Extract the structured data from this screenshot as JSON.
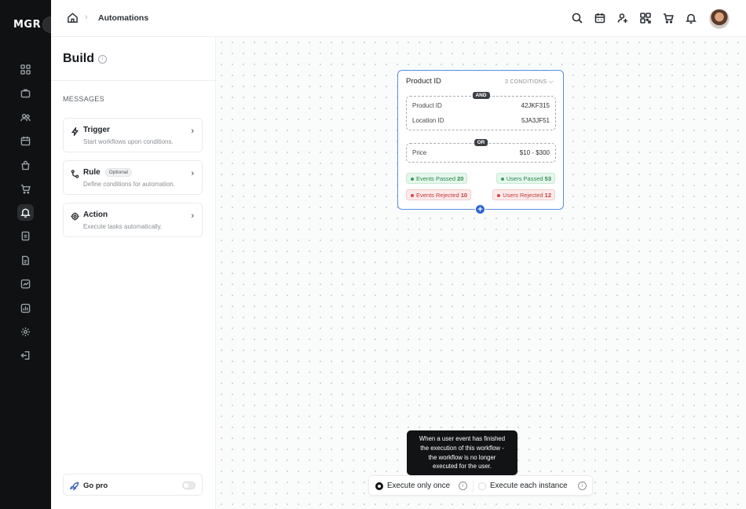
{
  "app": {
    "logo": "MGR"
  },
  "rail": {
    "items": [
      {
        "icon": "grid-icon"
      },
      {
        "icon": "briefcase-icon"
      },
      {
        "icon": "users-icon"
      },
      {
        "icon": "calendar-icon"
      },
      {
        "icon": "bag-icon"
      },
      {
        "icon": "cart-icon"
      },
      {
        "icon": "bell-icon",
        "active": true
      },
      {
        "icon": "document-icon"
      },
      {
        "icon": "file-icon"
      },
      {
        "icon": "chart-check-icon"
      },
      {
        "icon": "bar-chart-icon"
      },
      {
        "icon": "settings-icon"
      },
      {
        "icon": "logout-icon"
      }
    ]
  },
  "topbar": {
    "breadcrumb": "Automations",
    "icons": [
      "search-icon",
      "calendar-icon",
      "user-add-icon",
      "qr-icon",
      "cart-icon",
      "bell-icon"
    ]
  },
  "panel": {
    "title": "Build",
    "info_glyph": "i",
    "section_label": "MESSAGES",
    "cards": {
      "trigger": {
        "title": "Trigger",
        "desc": "Start workflows upon conditions."
      },
      "rule": {
        "title": "Rule",
        "badge": "Optional",
        "desc": "Define conditions for automation."
      },
      "action": {
        "title": "Action",
        "desc": "Execute tasks automatically."
      }
    },
    "gopro": "Go pro"
  },
  "node": {
    "title": "Product ID",
    "conditions": "3 CONDITIONS",
    "and_badge": "AND",
    "or_badge": "OR",
    "rows": {
      "product_id": {
        "label": "Product ID",
        "value": "42JKF315"
      },
      "location_id": {
        "label": "Location ID",
        "value": "5JA3JF51"
      },
      "price": {
        "label": "Price",
        "value": "$10 - $300"
      }
    },
    "stats": {
      "events_passed": {
        "label": "Events Passed",
        "value": "20"
      },
      "users_passed": {
        "label": "Users Passed",
        "value": "53"
      },
      "events_rejected": {
        "label": "Events Rejected",
        "value": "10"
      },
      "users_rejected": {
        "label": "Users Rejected",
        "value": "12"
      }
    },
    "add_glyph": "+"
  },
  "tooltip": {
    "lines": [
      "When a user event has finished",
      "the execution of this workflow -",
      "the workflow is no longer",
      "executed for the user."
    ]
  },
  "execute": {
    "once": {
      "label": "Execute only once",
      "selected": true
    },
    "each": {
      "label": "Execute each instance",
      "selected": false
    },
    "info_glyph": "i"
  },
  "colors": {
    "rail_bg": "#0f1112",
    "accent_blue": "#2c64d6",
    "node_border": "#5b8ee0",
    "success": "#2a8a4c",
    "danger": "#c23a3a"
  }
}
